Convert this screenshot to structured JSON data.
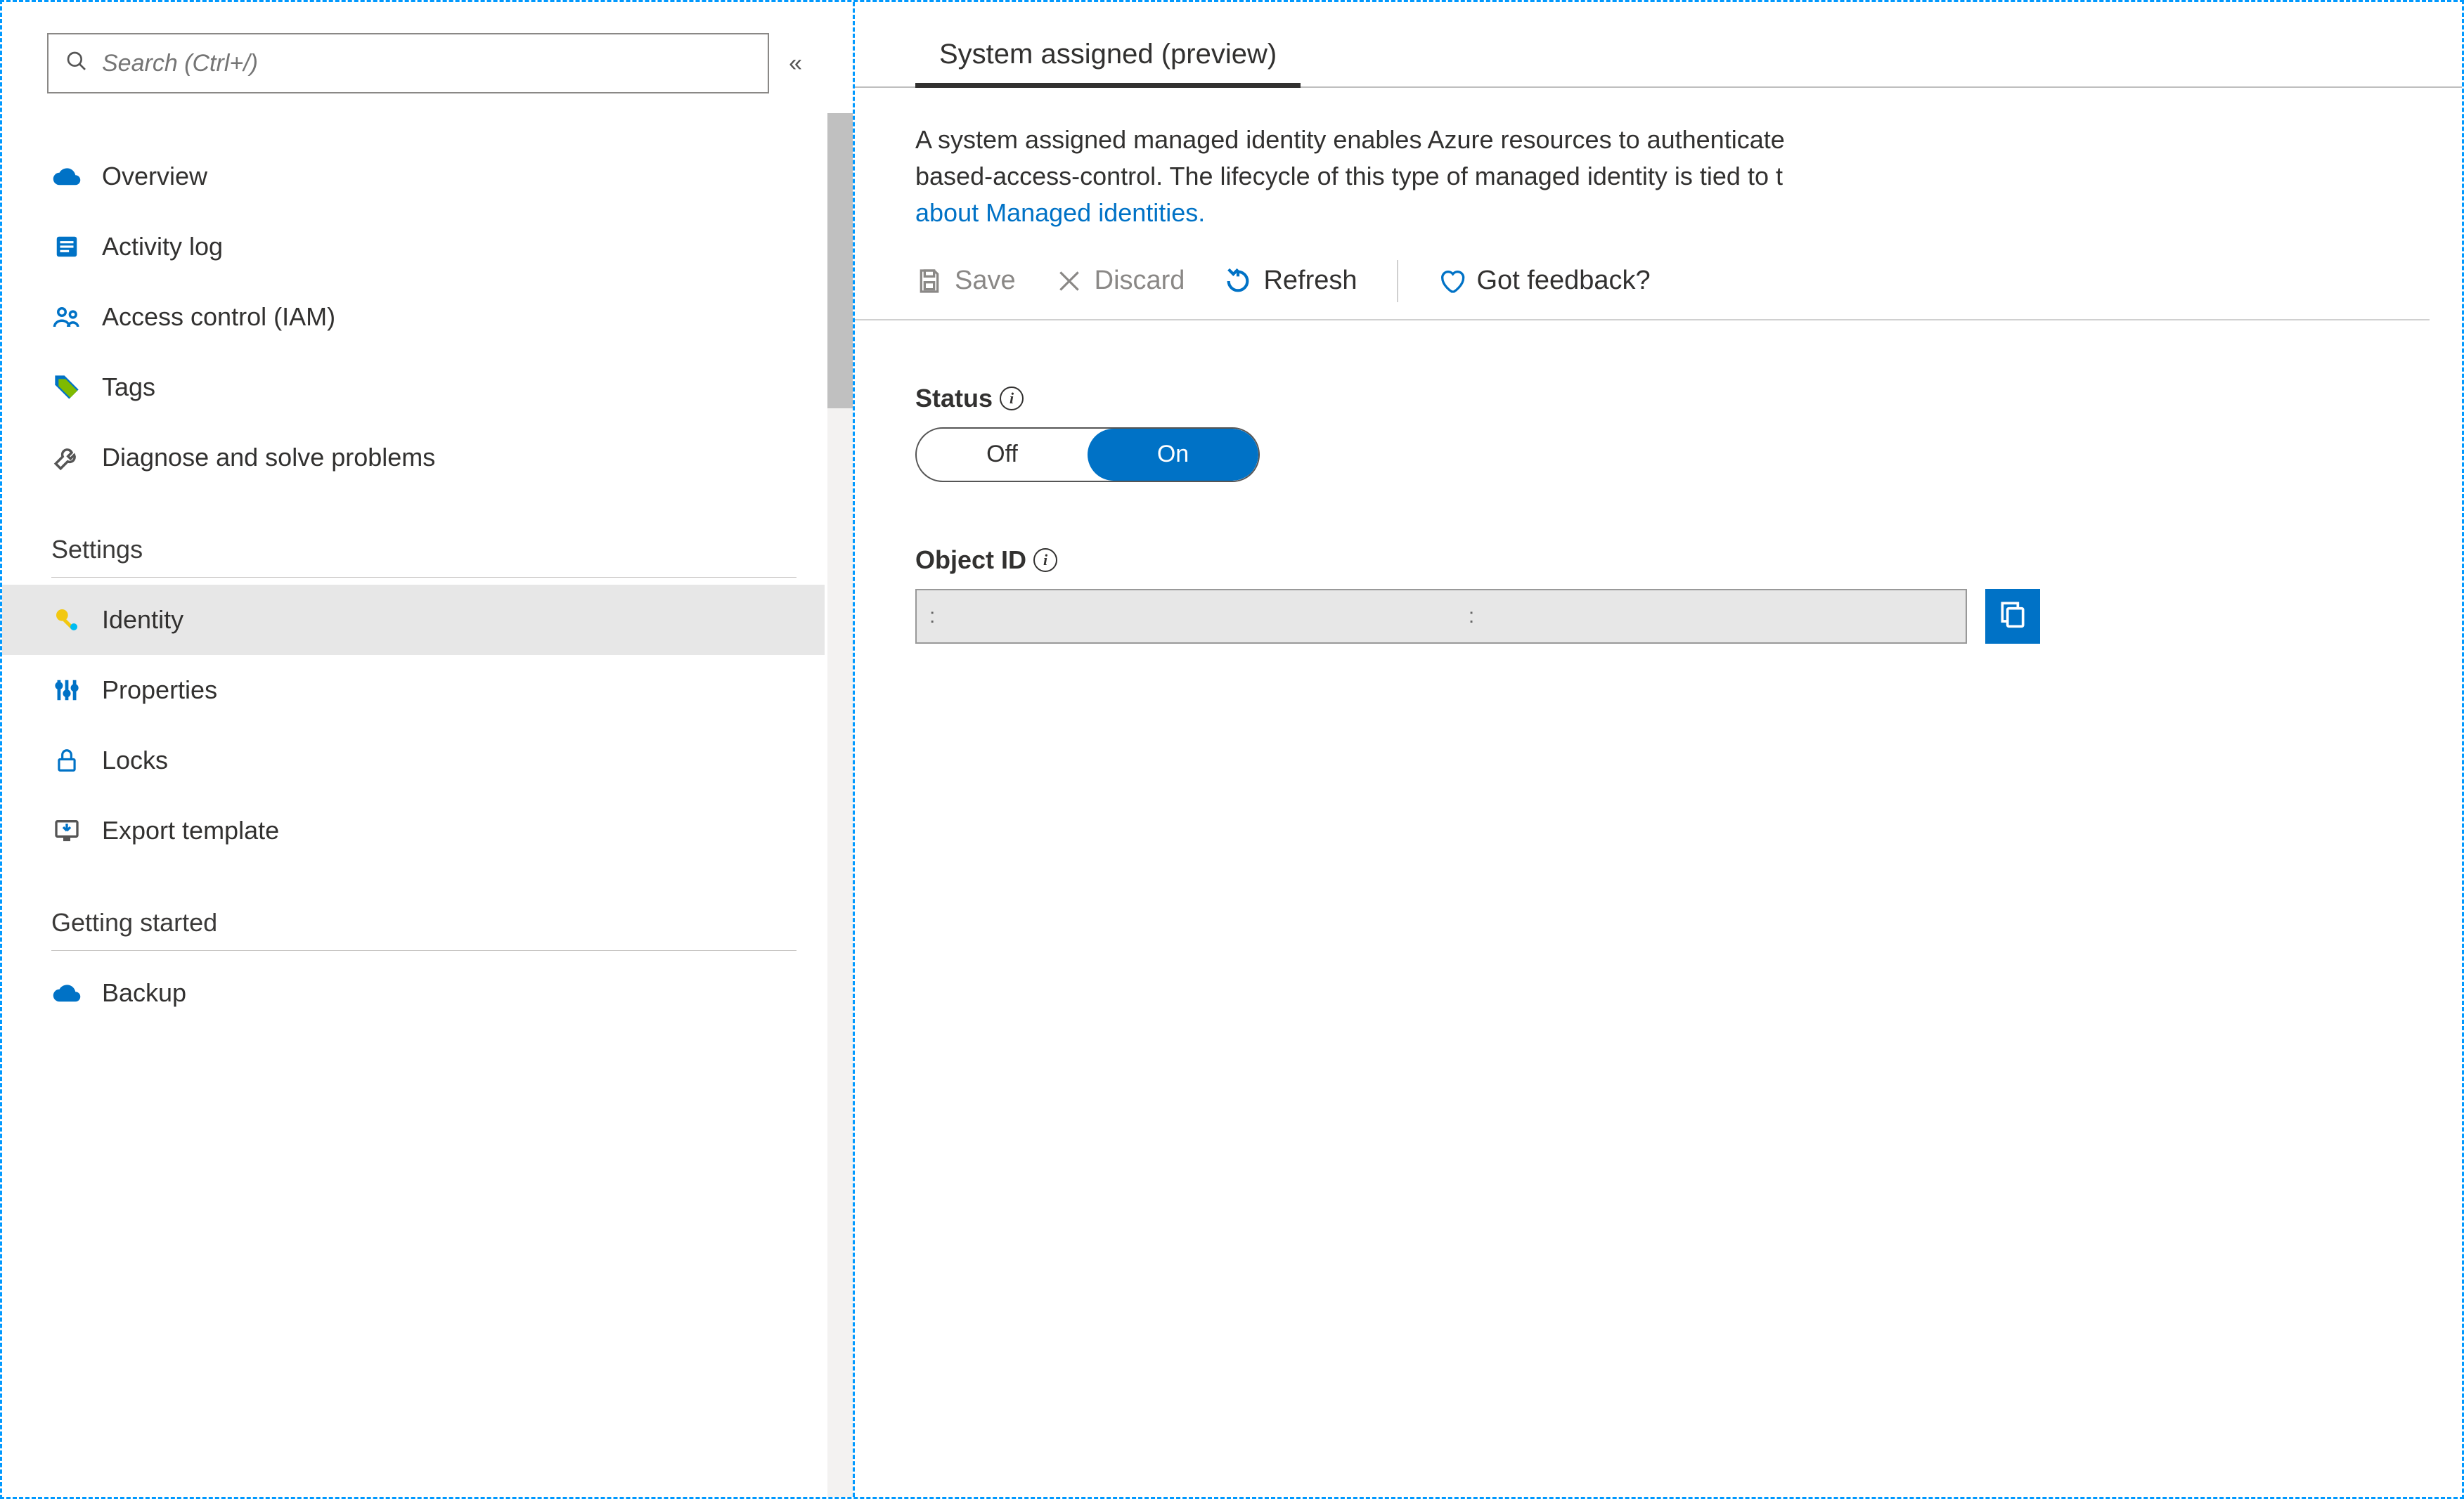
{
  "sidebar": {
    "search_placeholder": "Search (Ctrl+/)",
    "items_top": [
      {
        "label": "Overview",
        "icon": "cloud"
      },
      {
        "label": "Activity log",
        "icon": "log"
      },
      {
        "label": "Access control (IAM)",
        "icon": "iam"
      },
      {
        "label": "Tags",
        "icon": "tags"
      },
      {
        "label": "Diagnose and solve problems",
        "icon": "wrench"
      }
    ],
    "sections": [
      {
        "title": "Settings",
        "items": [
          {
            "label": "Identity",
            "icon": "key",
            "selected": true
          },
          {
            "label": "Properties",
            "icon": "sliders"
          },
          {
            "label": "Locks",
            "icon": "lock"
          },
          {
            "label": "Export template",
            "icon": "export"
          }
        ]
      },
      {
        "title": "Getting started",
        "items": [
          {
            "label": "Backup",
            "icon": "cloud"
          }
        ]
      }
    ]
  },
  "main": {
    "tab_label": "System assigned (preview)",
    "description_1": "A system assigned managed identity enables Azure resources to authenticate ",
    "description_2": "based-access-control. The lifecycle of this type of managed identity is tied to t",
    "description_link": "about Managed identities.",
    "toolbar": {
      "save": "Save",
      "discard": "Discard",
      "refresh": "Refresh",
      "feedback": "Got feedback?"
    },
    "status": {
      "label": "Status",
      "off": "Off",
      "on": "On",
      "value": "On"
    },
    "object_id": {
      "label": "Object ID",
      "value": ":                                                                                           :"
    }
  }
}
